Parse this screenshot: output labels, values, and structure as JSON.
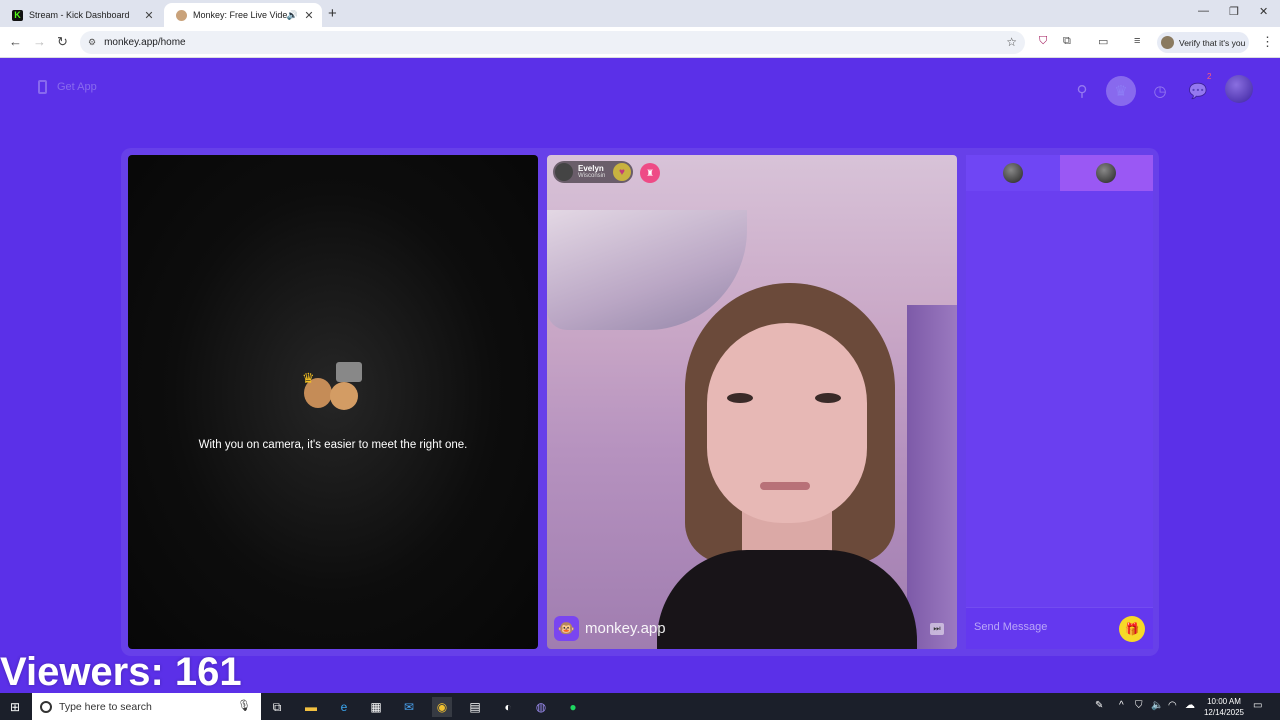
{
  "browser": {
    "tabs": [
      {
        "title": "Stream - Kick Dashboard",
        "active": false
      },
      {
        "title": "Monkey: Free Live Video Ch",
        "active": true
      }
    ],
    "url": "monkey.app/home",
    "verify_label": "Verify that it's you"
  },
  "page": {
    "get_app_label": "Get App",
    "notification_count": "2",
    "local_cam_message": "With you on camera, it's easier to meet the right one.",
    "remote_user": {
      "name": "Evelyn",
      "location": "Wisconsin"
    },
    "brand_label": "monkey.app",
    "chat": {
      "placeholder": "Send Message"
    }
  },
  "overlay": {
    "viewers_text": "Viewers: 161"
  },
  "taskbar": {
    "search_placeholder": "Type here to search",
    "time": "10:00 AM",
    "date": "12/14/2025"
  },
  "colors": {
    "page_bg": "#5b30e8",
    "chat_bg": "#6a3ff0",
    "send_btn": "#f7d928"
  }
}
